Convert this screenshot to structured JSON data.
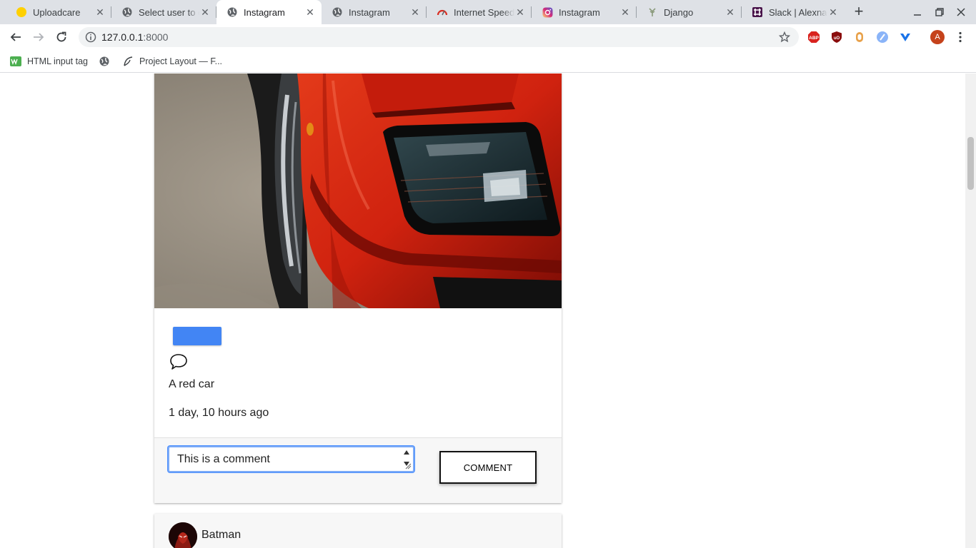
{
  "tabs": [
    {
      "title": "Uploadcare",
      "icon": "uploadcare-icon",
      "active": false
    },
    {
      "title": "Select user to change",
      "icon": "globe-icon",
      "active": false
    },
    {
      "title": "Instagram",
      "icon": "globe-icon",
      "active": true
    },
    {
      "title": "Instagram",
      "icon": "globe-icon",
      "active": false
    },
    {
      "title": "Internet Speed Test",
      "icon": "speedometer-icon",
      "active": false
    },
    {
      "title": "Instagram",
      "icon": "instagram-icon",
      "active": false
    },
    {
      "title": "Django",
      "icon": "django-icon",
      "active": false
    },
    {
      "title": "Slack | Alexnader",
      "icon": "slack-icon",
      "active": false
    }
  ],
  "address": {
    "host": "127.0.0.1",
    "port": ":8000"
  },
  "bookmarks": [
    {
      "label": "HTML input tag",
      "icon": "w3-icon"
    },
    {
      "label": "",
      "icon": "globe-icon"
    },
    {
      "label": "Project Layout — F...",
      "icon": "feather-icon"
    }
  ],
  "profile_initial": "A",
  "extensions": [
    "adblock-plus-icon",
    "ublock-icon",
    "extension-icon",
    "extension-icon",
    "extension-icon"
  ],
  "post": {
    "caption": "A red car",
    "time_ago": "1 day, 10 hours ago",
    "comment_value": "This is a comment",
    "comment_button": "COMMENT"
  },
  "next_post": {
    "username": "Batman"
  },
  "colors": {
    "like_button": "#4285f4",
    "tab_strip": "#dee1e6",
    "omnibox": "#f1f3f4"
  }
}
